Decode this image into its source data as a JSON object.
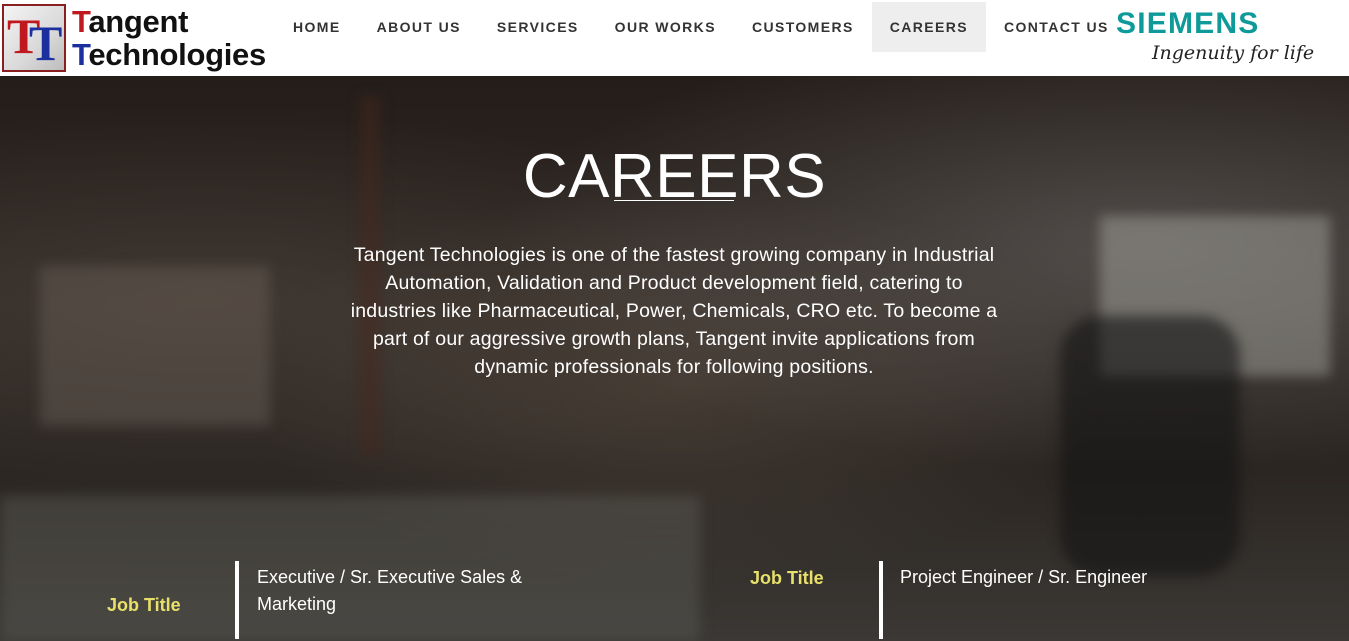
{
  "header": {
    "logo": {
      "mark": [
        "T",
        "T"
      ],
      "line1_initial": "T",
      "line1_rest": "angent",
      "line2_initial": "T",
      "line2_rest": "echnologies"
    },
    "nav": [
      {
        "label": "HOME"
      },
      {
        "label": "ABOUT US"
      },
      {
        "label": "SERVICES"
      },
      {
        "label": "OUR WORKS"
      },
      {
        "label": "CUSTOMERS"
      },
      {
        "label": "CAREERS"
      },
      {
        "label": "CONTACT US"
      }
    ],
    "active_nav": "CAREERS",
    "partner": {
      "name": "SIEMENS",
      "tagline": "Ingenuity for life"
    }
  },
  "hero": {
    "title": "CAREERS",
    "description": "Tangent Technologies is one of the fastest growing company in Industrial Automation, Validation and Product development field, catering to industries like Pharmaceutical, Power, Chemicals, CRO etc. To become a part of our aggressive growth plans, Tangent invite applications from dynamic professionals for following positions."
  },
  "jobs": [
    {
      "label": "Job Title",
      "title": "Executive / Sr. Executive Sales & Marketing"
    },
    {
      "label": "Job Title",
      "title": "Project Engineer / Sr. Engineer"
    }
  ],
  "colors": {
    "accent_job_label": "#e8e06a",
    "siemens_teal": "#0f9a9a",
    "logo_red": "#c0181f",
    "logo_blue": "#1b2f9e"
  }
}
